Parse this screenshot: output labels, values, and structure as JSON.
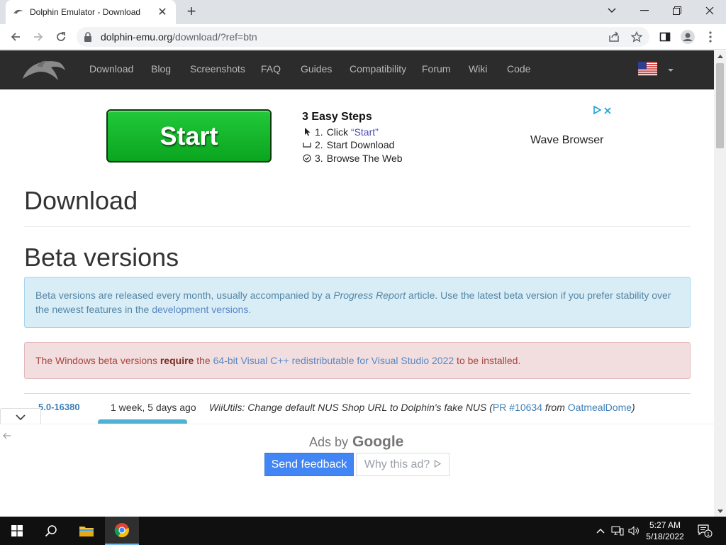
{
  "browser": {
    "tab_title": "Dolphin Emulator - Download",
    "tab_close": "✕",
    "new_tab": "+",
    "url_host": "dolphin-emu.org",
    "url_path": "/download/?ref=btn"
  },
  "site_nav": {
    "links": [
      "Download",
      "Blog",
      "Screenshots",
      "FAQ",
      "Guides",
      "Compatibility",
      "Forum",
      "Wiki",
      "Code"
    ]
  },
  "ad": {
    "start_label": "Start",
    "steps_title": "3 Easy Steps",
    "step1_num": "1.",
    "step1_prefix": "Click ",
    "step1_quote": "“Start”",
    "step2_num": "2.",
    "step2_text": "Start Download",
    "step3_num": "3.",
    "step3_text": "Browse The Web",
    "advertiser": "Wave Browser"
  },
  "page": {
    "title": "Download",
    "beta_heading": "Beta versions",
    "info_1": "Beta versions are released every month, usually accompanied by a ",
    "info_em": "Progress Report",
    "info_2": " article. Use the latest beta version if you prefer stability over the newest features in the ",
    "info_link": "development versions.",
    "warn_1": "The Windows beta versions ",
    "warn_bold": "require",
    "warn_2": " the ",
    "warn_link": "64-bit Visual C++ redistributable for Visual Studio 2022",
    "warn_3": " to be installed.",
    "release": {
      "version": "5.0-16380",
      "age": "1 week, 5 days ago",
      "desc_1": "WiiUtils: Change default NUS Shop URL to Dolphin's fake NUS (",
      "pr": "PR #10634",
      "desc_2": " from ",
      "author": "OatmealDome",
      "desc_3": ")"
    }
  },
  "anchor_ad": {
    "ads_by": "Ads by",
    "google": "Google",
    "send_feedback": "Send feedback",
    "why_this_ad": "Why this ad?"
  },
  "taskbar": {
    "time": "5:27 AM",
    "date": "5/18/2022",
    "notification_count": "1"
  }
}
